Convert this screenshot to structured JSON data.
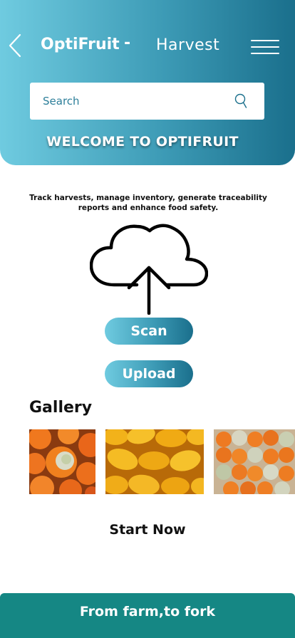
{
  "header": {
    "app_name": "OptiFruit",
    "separator": "-",
    "page_title": "Harvest",
    "back_icon": "chevron-left-icon",
    "menu_icon": "hamburger-menu-icon"
  },
  "search": {
    "placeholder": "Search",
    "icon": "search-icon"
  },
  "welcome_text": "WELCOME TO OPTIFRUIT",
  "tagline": "Track harvests, manage inventory, generate traceability reports and enhance food safety.",
  "upload_graphic": "cloud-upload-icon",
  "actions": {
    "scan_label": "Scan",
    "upload_label": "Upload"
  },
  "gallery": {
    "title": "Gallery"
  },
  "start_now_label": "Start Now",
  "footer": {
    "slogan": "From farm,to fork"
  },
  "colors": {
    "gradient_start": "#6fcbe0",
    "gradient_end": "#1a6f8c",
    "footer_bg": "#158784"
  }
}
